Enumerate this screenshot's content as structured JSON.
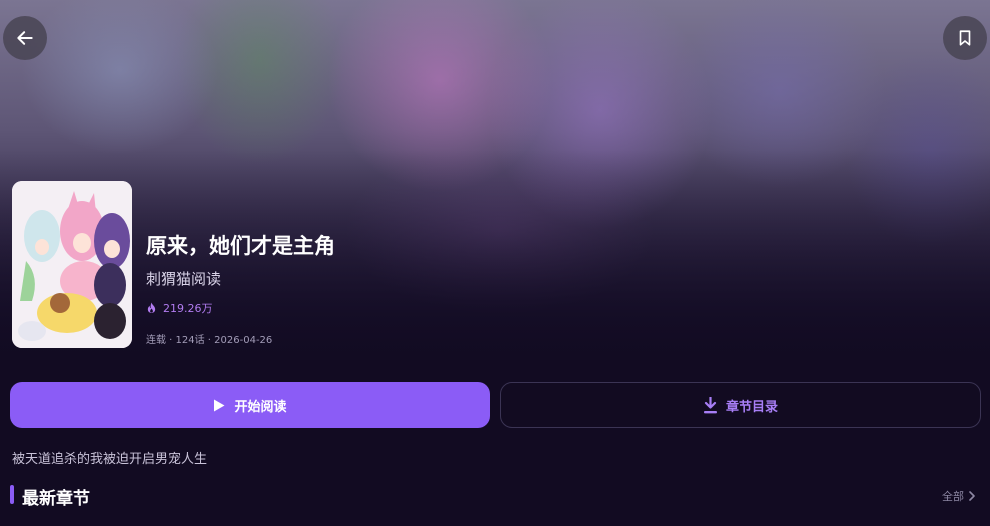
{
  "comic": {
    "title": "原来，她们才是主角",
    "author": "刺猬猫阅读",
    "heat": "219.26万",
    "meta": "连载 · 124话 · 2026-04-26",
    "description": "被天道追杀的我被迫开启男宠人生"
  },
  "actions": {
    "read_label": "开始阅读",
    "toc_label": "章节目录"
  },
  "section": {
    "title": "最新章节",
    "see_all_label": "全部"
  },
  "icons": {
    "back": "arrow-left-icon",
    "bookmark": "bookmark-icon",
    "heat": "flame-icon",
    "play": "play-icon",
    "download": "download-icon",
    "chevron": "chevron-right-icon"
  },
  "colors": {
    "accent": "#8b5cf6",
    "accent_text": "#a77ef5",
    "background": "#120b22"
  }
}
